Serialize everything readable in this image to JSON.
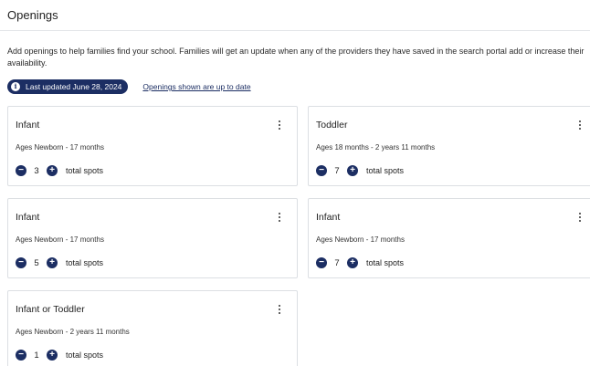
{
  "page": {
    "title": "Openings",
    "description": "Add openings to help families find your school. Families will get an update when any of the providers they have saved in the search portal add or increase their availability."
  },
  "status": {
    "last_updated": "Last updated June 28, 2024",
    "uptodate_link": "Openings shown are up to date",
    "info_icon_glyph": "i"
  },
  "colors": {
    "accent": "#1c2e63",
    "border": "#dcdfe3"
  },
  "counter": {
    "minus_glyph": "−",
    "plus_glyph": "+",
    "spots_label": "total spots"
  },
  "cards": [
    {
      "title": "Infant",
      "ages": "Ages Newborn - 17 months",
      "count": "3"
    },
    {
      "title": "Toddler",
      "ages": "Ages 18 months - 2 years 11 months",
      "count": "7"
    },
    {
      "title": "Infant",
      "ages": "Ages Newborn - 17 months",
      "count": "5"
    },
    {
      "title": "Infant",
      "ages": "Ages Newborn - 17 months",
      "count": "7"
    },
    {
      "title": "Infant or Toddler",
      "ages": "Ages Newborn - 2 years 11 months",
      "count": "1"
    }
  ]
}
